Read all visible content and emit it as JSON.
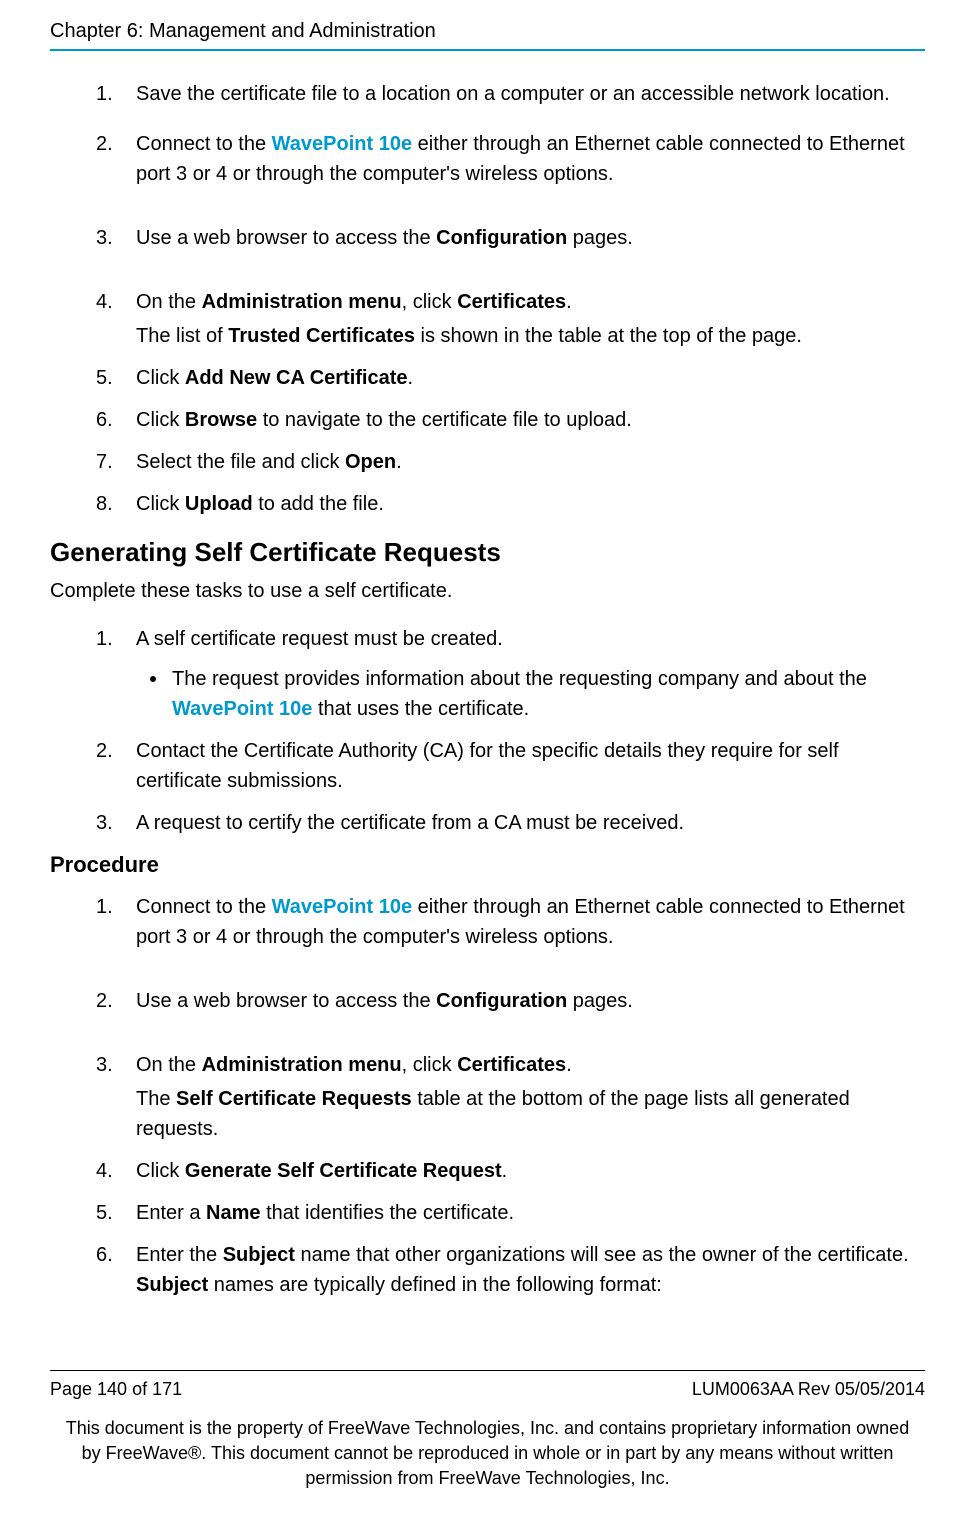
{
  "header": {
    "chapter_title": "Chapter 6: Management and Administration"
  },
  "links": {
    "wavepoint": "WavePoint 10e"
  },
  "list1": {
    "item1": "Save the certificate file to a location on a computer or an accessible network location.",
    "item2_a": "Connect to the ",
    "item2_b": " either through an Ethernet cable connected to Ethernet port 3 or 4 or through the computer's wireless options.",
    "item3_a": "Use a web browser to access the ",
    "item3_bold": "Configuration",
    "item3_b": " pages.",
    "item4_a": "On the ",
    "item4_bold1": "Administration menu",
    "item4_b": ", click ",
    "item4_bold2": "Certificates",
    "item4_c": ".",
    "item4_line2_a": "The list of ",
    "item4_line2_bold": "Trusted Certificates",
    "item4_line2_b": " is shown in the table at the top of the page.",
    "item5_a": "Click ",
    "item5_bold": "Add New CA Certificate",
    "item5_b": ".",
    "item6_a": "Click ",
    "item6_bold": "Browse",
    "item6_b": " to navigate to the certificate file to upload.",
    "item7_a": "Select the file and click ",
    "item7_bold": "Open",
    "item7_b": ".",
    "item8_a": "Click ",
    "item8_bold": "Upload",
    "item8_b": " to add the file."
  },
  "h2": "Generating Self Certificate Requests",
  "h2_after": "Complete these tasks to use a self certificate.",
  "list2": {
    "item1": "A self certificate request must be created.",
    "item1_bullet_a": "The request provides information about the requesting company and about the ",
    "item1_bullet_b": " that uses the certificate.",
    "item2": "Contact the Certificate Authority (CA) for the specific details they require for self certificate submissions.",
    "item3": "A request to certify the certificate from a CA must be received."
  },
  "h3": "Procedure",
  "list3": {
    "item1_a": "Connect to the ",
    "item1_b": " either through an Ethernet cable connected to Ethernet port 3 or 4 or through the computer's wireless options.",
    "item2_a": "Use a web browser to access the ",
    "item2_bold": "Configuration",
    "item2_b": " pages.",
    "item3_a": "On the ",
    "item3_bold1": "Administration menu",
    "item3_b": ", click ",
    "item3_bold2": "Certificates",
    "item3_c": ".",
    "item3_line2_a": "The ",
    "item3_line2_bold": "Self Certificate Requests",
    "item3_line2_b": " table at the bottom of the page lists all generated requests.",
    "item4_a": "Click ",
    "item4_bold": "Generate Self Certificate Request",
    "item4_b": ".",
    "item5_a": "Enter a ",
    "item5_bold": "Name",
    "item5_b": " that identifies the certificate.",
    "item6_a": "Enter the ",
    "item6_bold1": "Subject",
    "item6_b": " name that other organizations will see as the owner of the certificate. ",
    "item6_bold2": "Subject",
    "item6_c": " names are typically defined in the following format:"
  },
  "footer": {
    "page_info": "Page 140 of 171",
    "doc_rev": "LUM0063AA Rev 05/05/2014",
    "legal": "This document is the property of FreeWave Technologies, Inc. and contains proprietary information owned by FreeWave®. This document cannot be reproduced in whole or in part by any means without written permission from FreeWave Technologies, Inc."
  }
}
